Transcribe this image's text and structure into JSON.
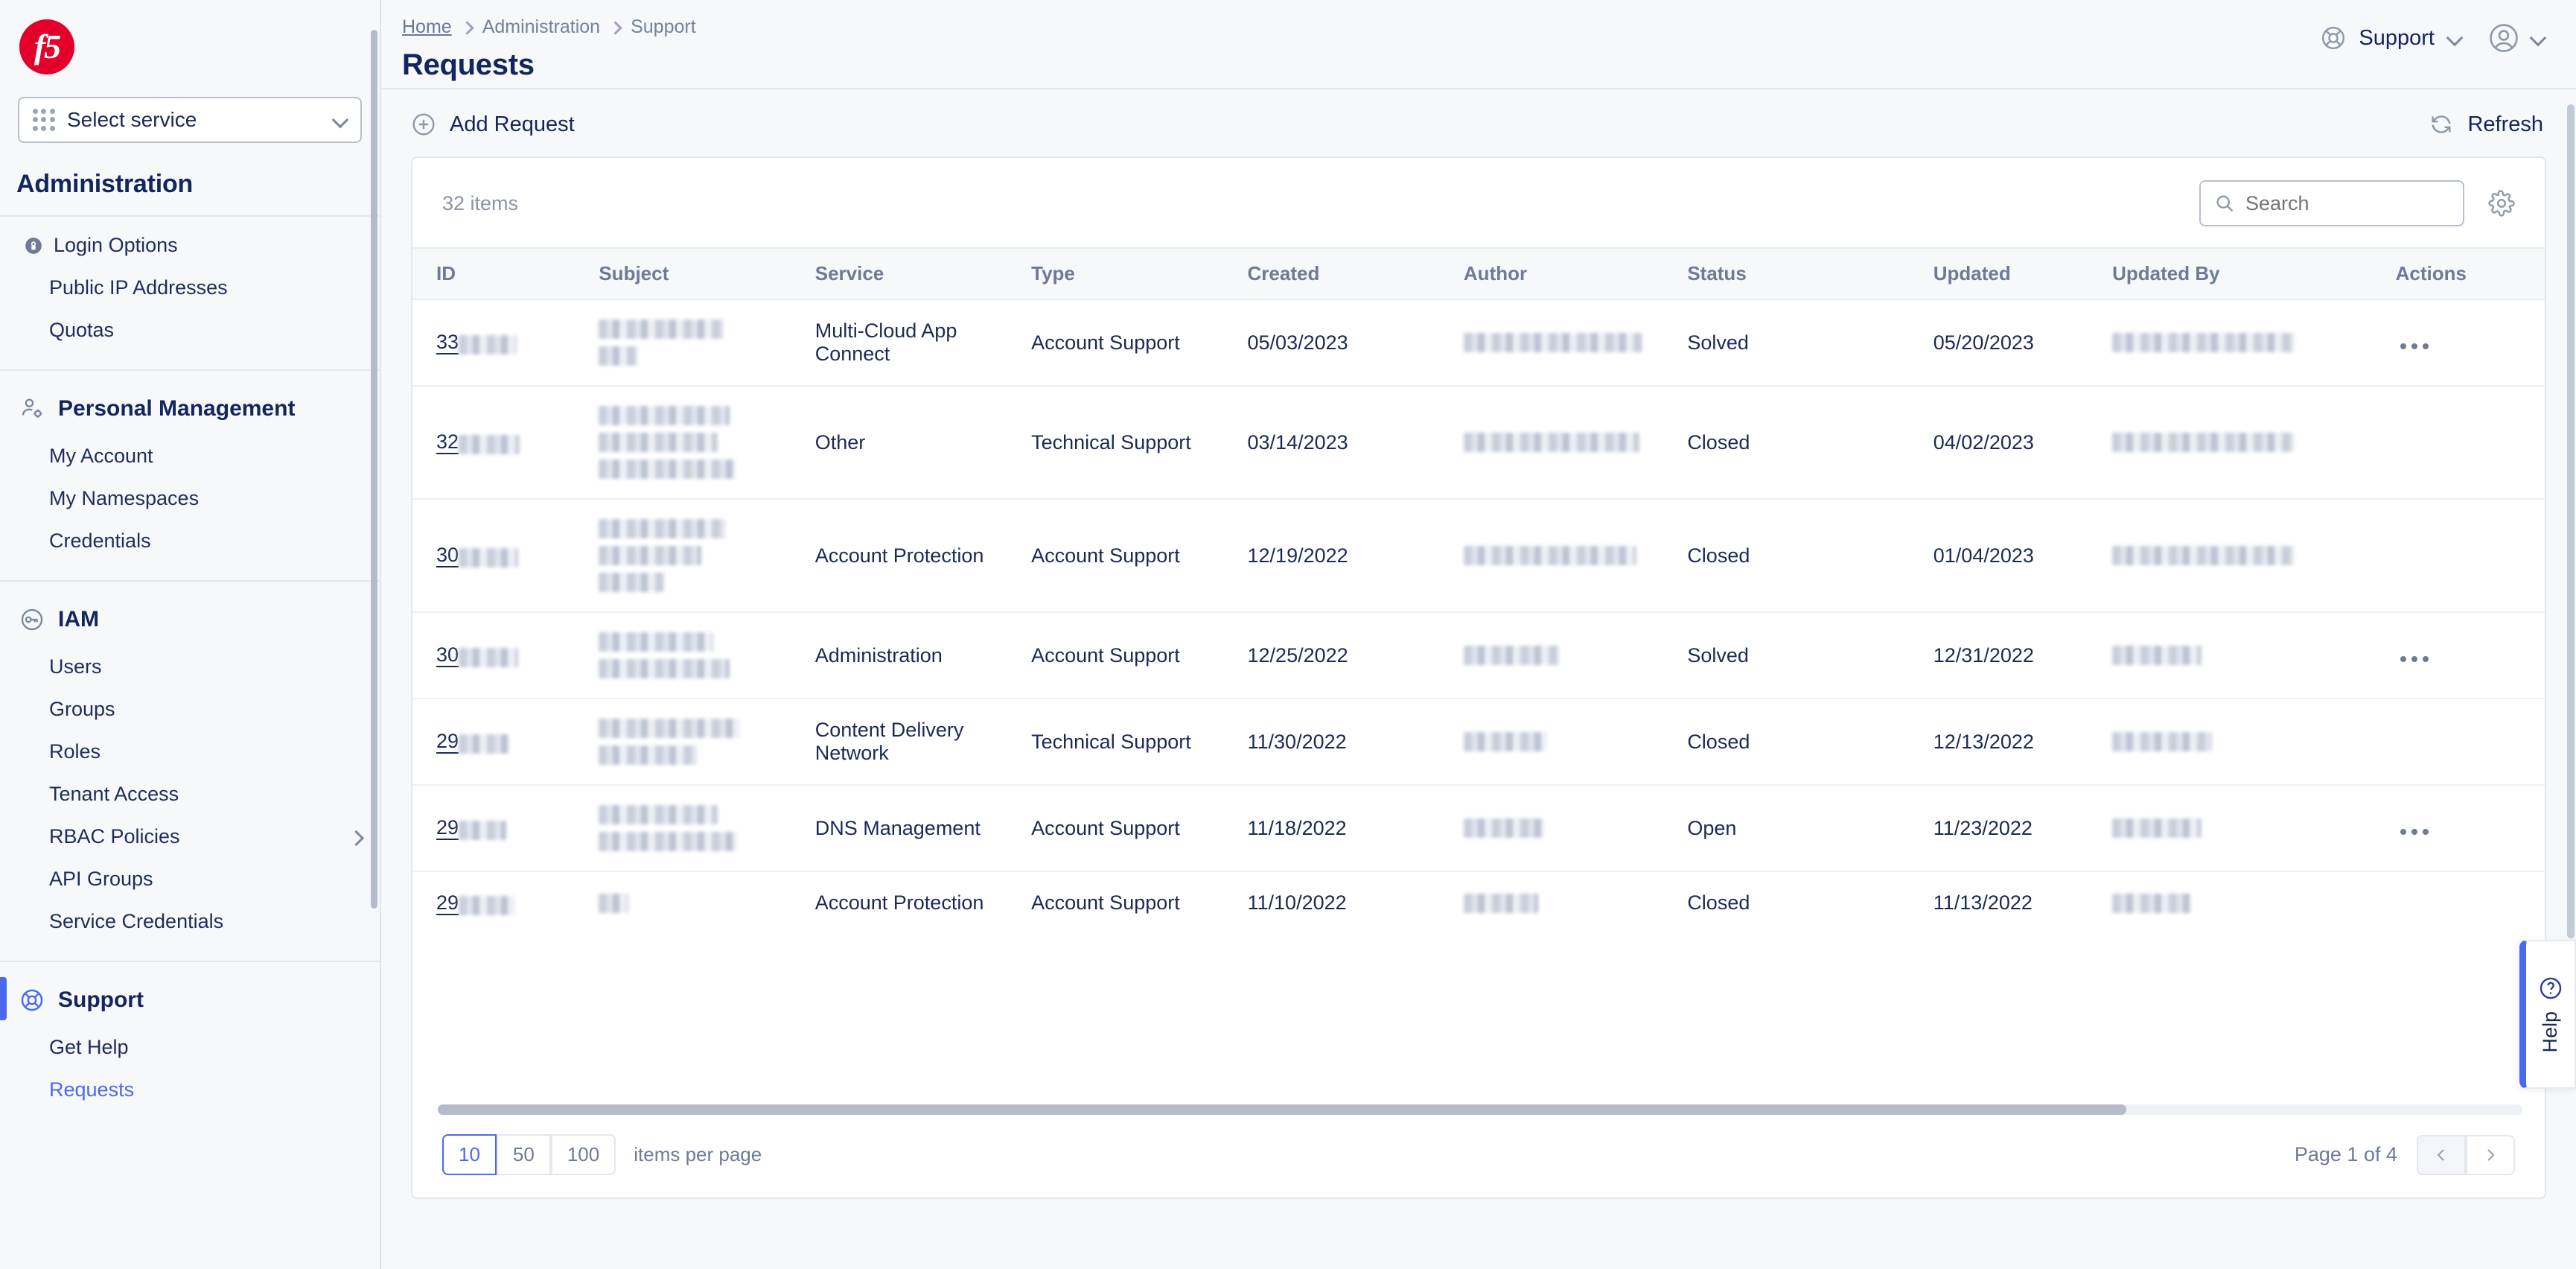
{
  "brand": {
    "logo_text": "f5",
    "accent": "#4b69f0",
    "brand_red": "#e4002b"
  },
  "sidebar": {
    "service_selector": {
      "label": "Select service",
      "icon": "grid-icon",
      "chevron": "chevron-down-icon"
    },
    "title": "Administration",
    "groups": [
      {
        "items": [
          {
            "label": "Login Options",
            "icon": "lock-icon"
          },
          {
            "label": "Public IP Addresses",
            "icon": null
          },
          {
            "label": "Quotas",
            "icon": null
          }
        ]
      },
      {
        "header": {
          "label": "Personal Management",
          "icon": "user-gear-icon",
          "active": false
        },
        "items": [
          {
            "label": "My Account",
            "icon": null
          },
          {
            "label": "My Namespaces",
            "icon": null
          },
          {
            "label": "Credentials",
            "icon": null
          }
        ]
      },
      {
        "header": {
          "label": "IAM",
          "icon": "key-icon",
          "active": false
        },
        "items": [
          {
            "label": "Users",
            "icon": null
          },
          {
            "label": "Groups",
            "icon": null
          },
          {
            "label": "Roles",
            "icon": null
          },
          {
            "label": "Tenant Access",
            "icon": null
          },
          {
            "label": "RBAC Policies",
            "icon": null,
            "expandable": true
          },
          {
            "label": "API Groups",
            "icon": null
          },
          {
            "label": "Service Credentials",
            "icon": null
          }
        ]
      },
      {
        "header": {
          "label": "Support",
          "icon": "lifebuoy-icon",
          "active": true
        },
        "items": [
          {
            "label": "Get Help",
            "icon": null
          },
          {
            "label": "Requests",
            "icon": null,
            "selected": true
          }
        ]
      }
    ]
  },
  "header": {
    "breadcrumb": [
      {
        "label": "Home",
        "link": true
      },
      {
        "label": "Administration",
        "link": false
      },
      {
        "label": "Support",
        "link": false
      }
    ],
    "page_title": "Requests",
    "support_menu": {
      "label": "Support",
      "icon": "lifebuoy-icon",
      "chevron": "chevron-down-icon"
    },
    "account_menu": {
      "icon": "user-avatar-icon",
      "chevron": "chevron-down-icon"
    }
  },
  "toolbar": {
    "add_request_label": "Add Request",
    "add_request_icon": "plus-circle-icon",
    "refresh_label": "Refresh",
    "refresh_icon": "refresh-icon"
  },
  "table_panel": {
    "items_count": "32 items",
    "search": {
      "placeholder": "Search",
      "value": "",
      "icon": "search-icon"
    },
    "settings_icon": "gear-icon",
    "columns": [
      "ID",
      "Subject",
      "Service",
      "Type",
      "Created",
      "Author",
      "Status",
      "Updated",
      "Updated By",
      "Actions"
    ],
    "rows": [
      {
        "id_visible": "33",
        "id_redacted_width": 78,
        "subject_redacted": [
          168,
          52
        ],
        "service": "Multi-Cloud App Connect",
        "type": "Account Support",
        "created": "05/03/2023",
        "author_redacted": [
          240
        ],
        "status": "Solved",
        "updated": "05/20/2023",
        "updated_by_redacted": [
          244
        ],
        "has_actions": true
      },
      {
        "id_visible": "32",
        "id_redacted_width": 82,
        "subject_redacted": [
          176,
          160,
          184
        ],
        "service": "Other",
        "type": "Technical Support",
        "created": "03/14/2023",
        "author_redacted": [
          236
        ],
        "status": "Closed",
        "updated": "04/02/2023",
        "updated_by_redacted": [
          244
        ],
        "has_actions": false
      },
      {
        "id_visible": "30",
        "id_redacted_width": 80,
        "subject_redacted": [
          170,
          138,
          88
        ],
        "service": "Account Protection",
        "type": "Account Support",
        "created": "12/19/2022",
        "author_redacted": [
          232
        ],
        "status": "Closed",
        "updated": "01/04/2023",
        "updated_by_redacted": [
          244
        ],
        "has_actions": false
      },
      {
        "id_visible": "30",
        "id_redacted_width": 80,
        "subject_redacted": [
          154,
          176
        ],
        "service": "Administration",
        "type": "Account Support",
        "created": "12/25/2022",
        "author_redacted": [
          128
        ],
        "status": "Solved",
        "updated": "12/31/2022",
        "updated_by_redacted": [
          120
        ],
        "has_actions": true
      },
      {
        "id_visible": "29",
        "id_redacted_width": 68,
        "subject_redacted": [
          190,
          132
        ],
        "service": "Content Delivery Network",
        "type": "Technical Support",
        "created": "11/30/2022",
        "author_redacted": [
          112
        ],
        "status": "Closed",
        "updated": "12/13/2022",
        "updated_by_redacted": [
          134
        ],
        "has_actions": false
      },
      {
        "id_visible": "29",
        "id_redacted_width": 64,
        "subject_redacted": [
          160,
          186
        ],
        "service": "DNS Management",
        "type": "Account Support",
        "created": "11/18/2022",
        "author_redacted": [
          108
        ],
        "status": "Open",
        "updated": "11/23/2022",
        "updated_by_redacted": [
          120
        ],
        "has_actions": true
      },
      {
        "id_visible": "29",
        "id_redacted_width": 76,
        "subject_redacted": [
          40
        ],
        "service": "Account Protection",
        "type": "Account Support",
        "created": "11/10/2022",
        "author_redacted": [
          100
        ],
        "status": "Closed",
        "updated": "11/13/2022",
        "updated_by_redacted": [
          106
        ],
        "has_actions": false
      }
    ],
    "actions_icon": "ellipsis-icon"
  },
  "footer": {
    "page_size_options": [
      "10",
      "50",
      "100"
    ],
    "page_size_selected": "10",
    "page_size_label": "items per page",
    "page_indicator": "Page 1 of 4",
    "prev_icon": "chevron-left-icon",
    "next_icon": "chevron-right-icon"
  },
  "help_tab": {
    "label": "Help",
    "icon": "question-circle-icon"
  }
}
